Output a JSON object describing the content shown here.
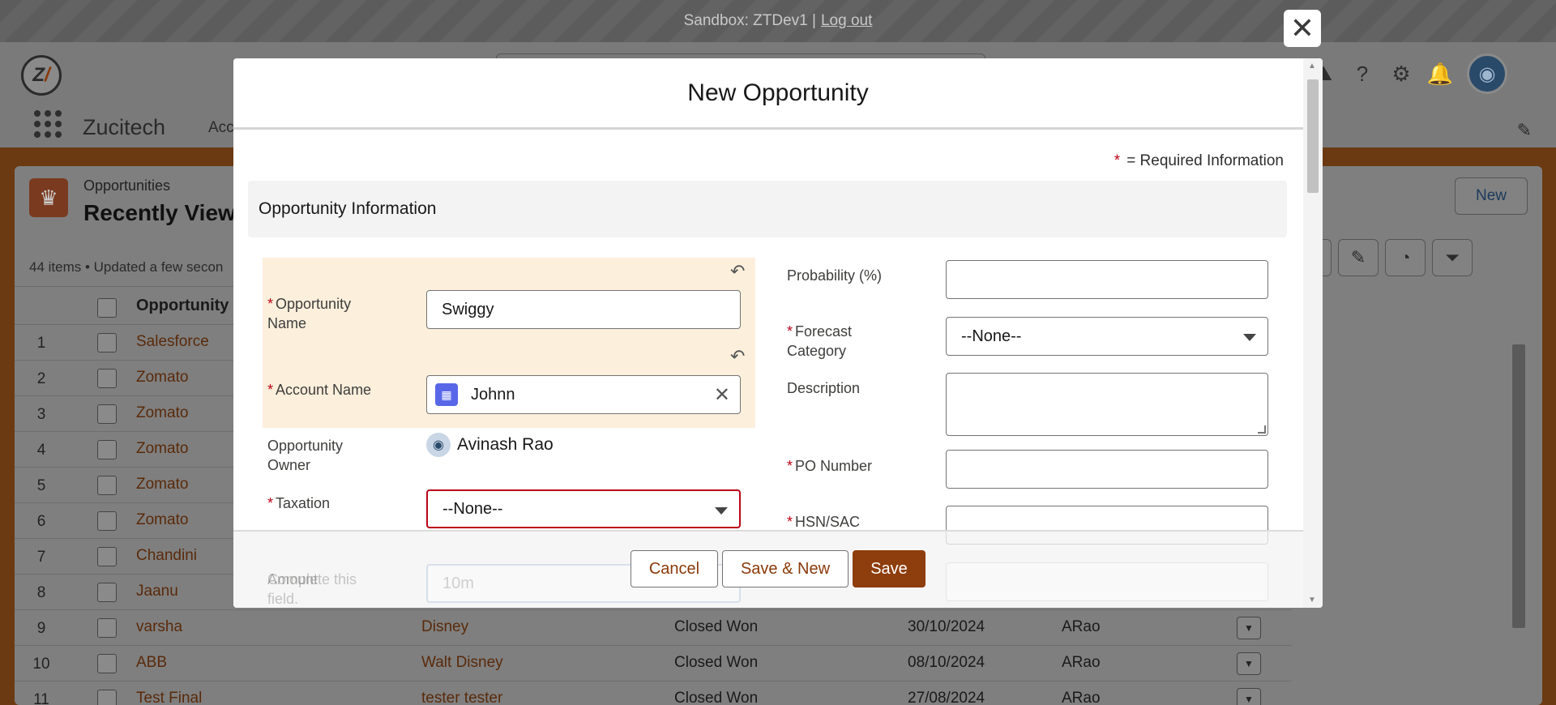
{
  "banner": {
    "text": "Sandbox: ZTDev1 |",
    "logout": "Log out"
  },
  "header": {
    "app_name": "Zucitech",
    "nav_partial": "Acc"
  },
  "list": {
    "object_label": "Opportunities",
    "title": "Recently Viewe",
    "meta": "44 items • Updated a few secon",
    "new_button": "New",
    "column_opportunity": "Opportunity",
    "rows": [
      {
        "num": "1",
        "name": "Salesforce",
        "account": "",
        "stage": "",
        "date": "",
        "owner": ""
      },
      {
        "num": "2",
        "name": "Zomato",
        "account": "",
        "stage": "",
        "date": "",
        "owner": ""
      },
      {
        "num": "3",
        "name": "Zomato",
        "account": "",
        "stage": "",
        "date": "",
        "owner": ""
      },
      {
        "num": "4",
        "name": "Zomato",
        "account": "",
        "stage": "",
        "date": "",
        "owner": ""
      },
      {
        "num": "5",
        "name": "Zomato",
        "account": "",
        "stage": "",
        "date": "",
        "owner": ""
      },
      {
        "num": "6",
        "name": "Zomato",
        "account": "",
        "stage": "",
        "date": "",
        "owner": ""
      },
      {
        "num": "7",
        "name": "Chandini",
        "account": "",
        "stage": "",
        "date": "",
        "owner": ""
      },
      {
        "num": "8",
        "name": "Jaanu",
        "account": "",
        "stage": "",
        "date": "",
        "owner": ""
      },
      {
        "num": "9",
        "name": "varsha",
        "account": "Disney",
        "stage": "Closed Won",
        "date": "30/10/2024",
        "owner": "ARao"
      },
      {
        "num": "10",
        "name": "ABB",
        "account": "Walt Disney",
        "stage": "Closed Won",
        "date": "08/10/2024",
        "owner": "ARao"
      },
      {
        "num": "11",
        "name": "Test Final",
        "account": "tester tester",
        "stage": "Closed Won",
        "date": "27/08/2024",
        "owner": "ARao"
      }
    ]
  },
  "modal": {
    "title": "New Opportunity",
    "required_info": "= Required Information",
    "required_star": "*",
    "section_title": "Opportunity Information",
    "fields": {
      "opportunity_name_label": "Opportunity Name",
      "opportunity_name_value": "Swiggy",
      "account_name_label": "Account Name",
      "account_name_value": "Johnn",
      "owner_label": "Opportunity Owner",
      "owner_value": "Avinash Rao",
      "taxation_label": "Taxation",
      "taxation_value": "--None--",
      "taxation_error": "Complete this field.",
      "amount_label": "Amount",
      "amount_placeholder": "10m",
      "probability_label": "Probability (%)",
      "forecast_label": "Forecast Category",
      "forecast_value": "--None--",
      "description_label": "Description",
      "po_label": "PO Number",
      "hsn_label": "HSN/SAC"
    },
    "buttons": {
      "cancel": "Cancel",
      "save_new": "Save & New",
      "save": "Save"
    }
  }
}
